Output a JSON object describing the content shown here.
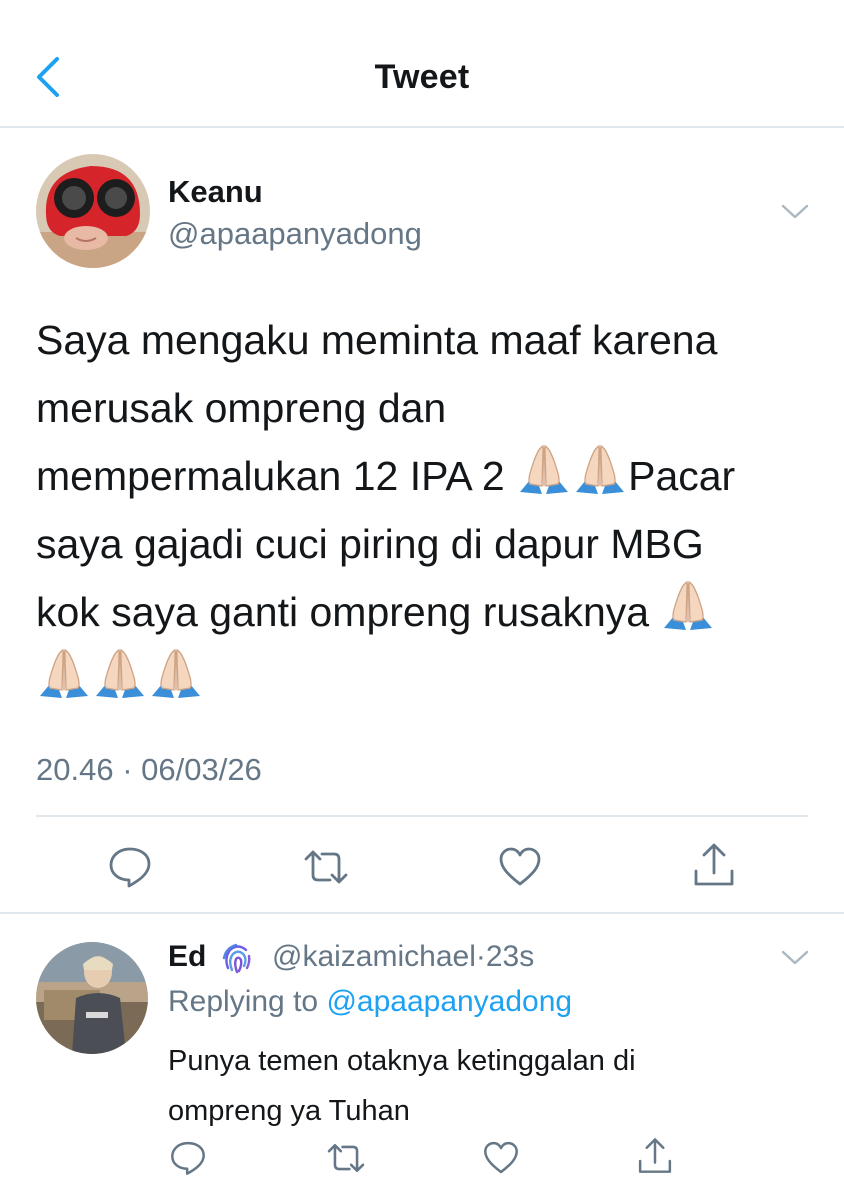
{
  "header": {
    "title": "Tweet",
    "back_icon": "chevron-left-icon"
  },
  "tweet": {
    "author_name": "Keanu",
    "author_handle": "@apaapanyadong",
    "text_lines": [
      "Saya mengaku meminta maaf karena",
      "merusak ompreng dan",
      "mempermalukan 12 IPA 2",
      "Pacar",
      "saya gajadi cuci piring di dapur MBG",
      "kok saya ganti ompreng rusaknya"
    ],
    "emoji": "folded-hands-icon",
    "timestamp": "20.46 · 06/03/26",
    "actions": [
      "comment-icon",
      "retweet-icon",
      "like-icon",
      "share-icon"
    ]
  },
  "reply": {
    "author_name": "Ed",
    "badge_icon": "fingerprint-icon",
    "handle": "@kaizamichael",
    "separator": "·",
    "time": "23s",
    "replying_prefix": "Replying to",
    "replying_to": "@apaapanyadong",
    "text_lines": [
      "Punya temen otaknya ketinggalan di",
      "ompreng ya Tuhan"
    ]
  },
  "colors": {
    "accent": "#1da1f2",
    "secondary_text": "#657786",
    "divider": "#e1e8ed",
    "primary_text": "#14171a"
  }
}
